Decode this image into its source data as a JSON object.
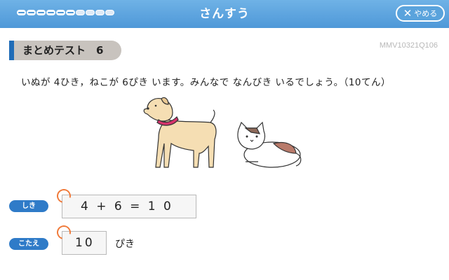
{
  "header": {
    "title": "さんすう",
    "quit_label": "やめる",
    "progress_done": 6,
    "progress_total": 10
  },
  "section": {
    "title": "まとめテスト　6",
    "question_code": "MMV10321Q106"
  },
  "question": {
    "text": "いぬが 4ひき，ねこが 6ぴき います。みんなで なんびき いるでしょう。（10てん）"
  },
  "formula": {
    "tag": "しき",
    "value": "4 + 6 = 1 0"
  },
  "answer": {
    "tag": "こたえ",
    "value": "10",
    "unit": "ぴき"
  },
  "colors": {
    "header": "#4e98d8",
    "accent": "#1f6cb7",
    "tag": "#2f7bc8",
    "mark": "#f07a3a"
  }
}
